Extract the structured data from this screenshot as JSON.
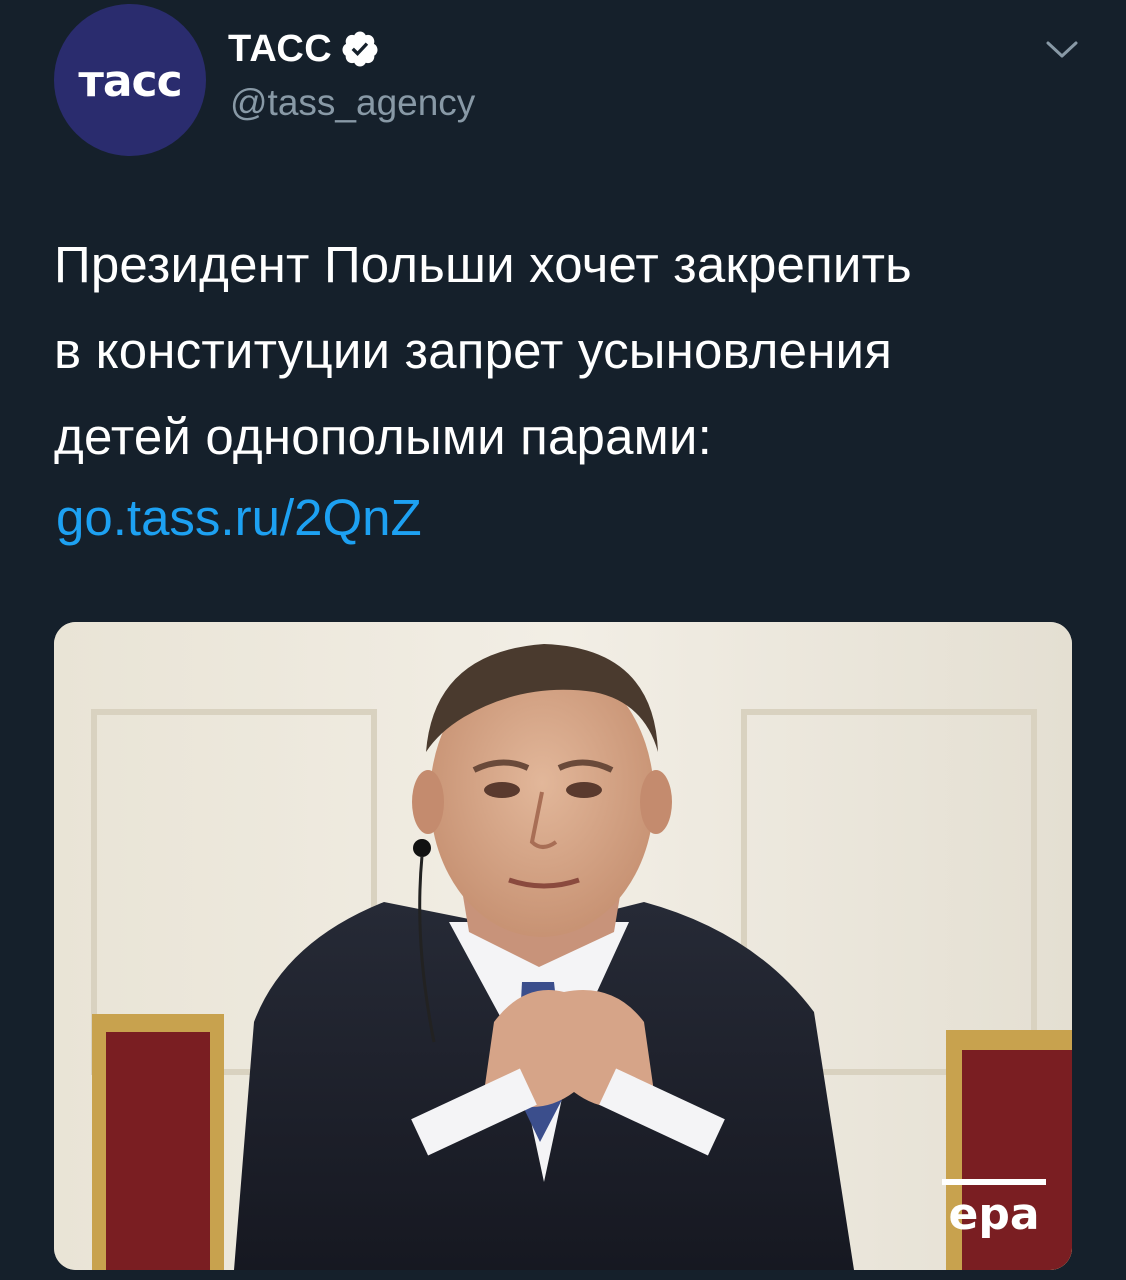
{
  "account": {
    "avatar_logo": "тасс",
    "display_name": "ТАСС",
    "handle": "@tass_agency",
    "verified": true
  },
  "tweet": {
    "text_lines": [
      "Президент Польши хочет закрепить",
      "в конституции запрет усыновления",
      "детей однополыми парами:"
    ],
    "link": "go.tass.ru/2QnZ"
  },
  "media": {
    "watermark": "epa"
  },
  "colors": {
    "background": "#15202b",
    "link": "#1da1f2",
    "secondary_text": "#8899a6",
    "verified_badge": "#ffffff",
    "avatar_bg": "#2a2c6e"
  },
  "icons": {
    "verified": "verified-badge-icon",
    "menu": "chevron-down-icon"
  }
}
